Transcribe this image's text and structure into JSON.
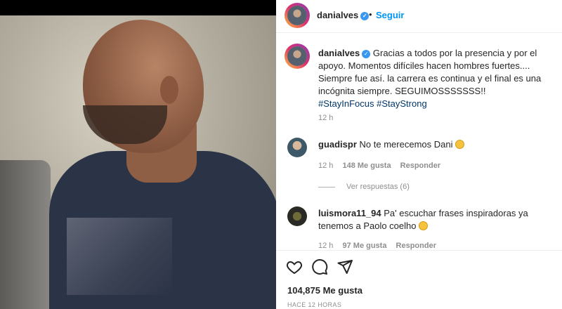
{
  "header": {
    "username": "danialves",
    "separator": "•",
    "follow_label": "Seguir"
  },
  "caption": {
    "username": "danialves",
    "text": "Gracias a todos por la presencia y por el apoyo. Momentos difíciles hacen hombres fuertes.... Siempre fue así. la carrera es continua y el final es una incógnita siempre. SEGUIMOSSSSSSS!!",
    "hashtag1": "#StayInFocus",
    "hashtag2": "#StayStrong",
    "time": "12 h"
  },
  "comments": [
    {
      "username": "guadispr",
      "text": "No te merecemos Dani",
      "emoji": "crying-face",
      "time": "12 h",
      "likes": "148 Me gusta",
      "reply": "Responder"
    },
    {
      "username": "luismora11_94",
      "text": "Pa' escuchar frases inspiradoras ya tenemos a Paolo coelho",
      "emoji": "crying-face",
      "time": "12 h",
      "likes": "97 Me gusta",
      "reply": "Responder"
    }
  ],
  "view_replies": "Ver respuestas (6)",
  "actions": {
    "icons": [
      "heart-icon",
      "comment-icon",
      "share-icon"
    ]
  },
  "likes": "104,875 Me gusta",
  "posted": "HACE 12 HORAS",
  "colors": {
    "link_blue": "#0095f6",
    "hashtag": "#00376b",
    "muted": "#8e8e8e",
    "verified": "#3897f0"
  }
}
